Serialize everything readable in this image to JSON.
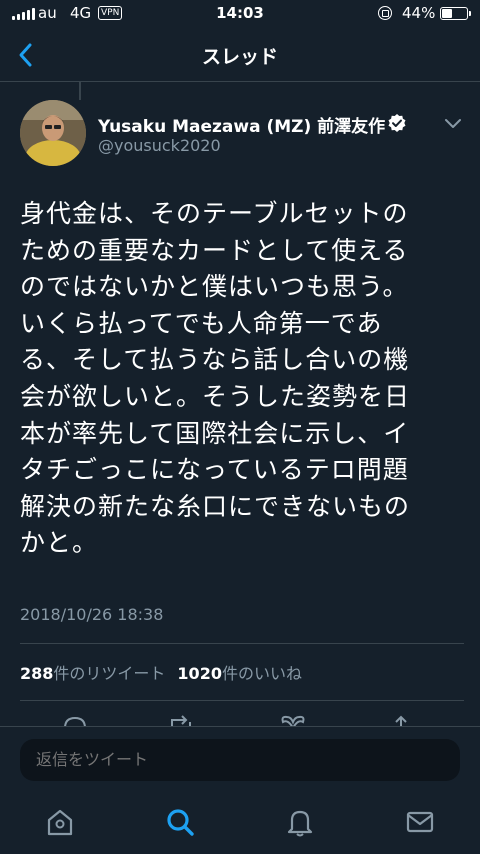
{
  "status_bar": {
    "carrier": "au",
    "network": "4G",
    "vpn_label": "VPN",
    "time": "14:03",
    "battery_percent_label": "44%",
    "battery_level": 0.44
  },
  "header": {
    "title": "スレッド",
    "back_icon": "chevron-left-icon"
  },
  "tweet": {
    "author_name": "Yusaku Maezawa (MZ) 前澤友作",
    "author_handle": "@yousuck2020",
    "verified": true,
    "text": "身代金は、そのテーブルセットの\nための重要なカードとして使える\nのではないかと僕はいつも思う。\nいくら払ってでも人命第一であ\nる、そして払うなら話し合いの機\n会が欲しいと。そうした姿勢を日\n本が率先して国際社会に示し、イ\nタチごっこになっているテロ問題\n解決の新たな糸口にできないもの\nかと。",
    "timestamp": "2018/10/26 18:38",
    "retweet_count": "288",
    "retweet_label": "件のリツイート",
    "like_count": "1020",
    "like_label": "件のいいね"
  },
  "reply": {
    "placeholder": "返信をツイート"
  },
  "tabs": [
    {
      "icon": "home-icon",
      "active": false
    },
    {
      "icon": "search-icon",
      "active": true
    },
    {
      "icon": "bell-icon",
      "active": false
    },
    {
      "icon": "mail-icon",
      "active": false
    }
  ],
  "colors": {
    "background": "#15202b",
    "accent": "#1da1f2",
    "secondary_text": "#8899a6",
    "divider": "#38444d"
  }
}
